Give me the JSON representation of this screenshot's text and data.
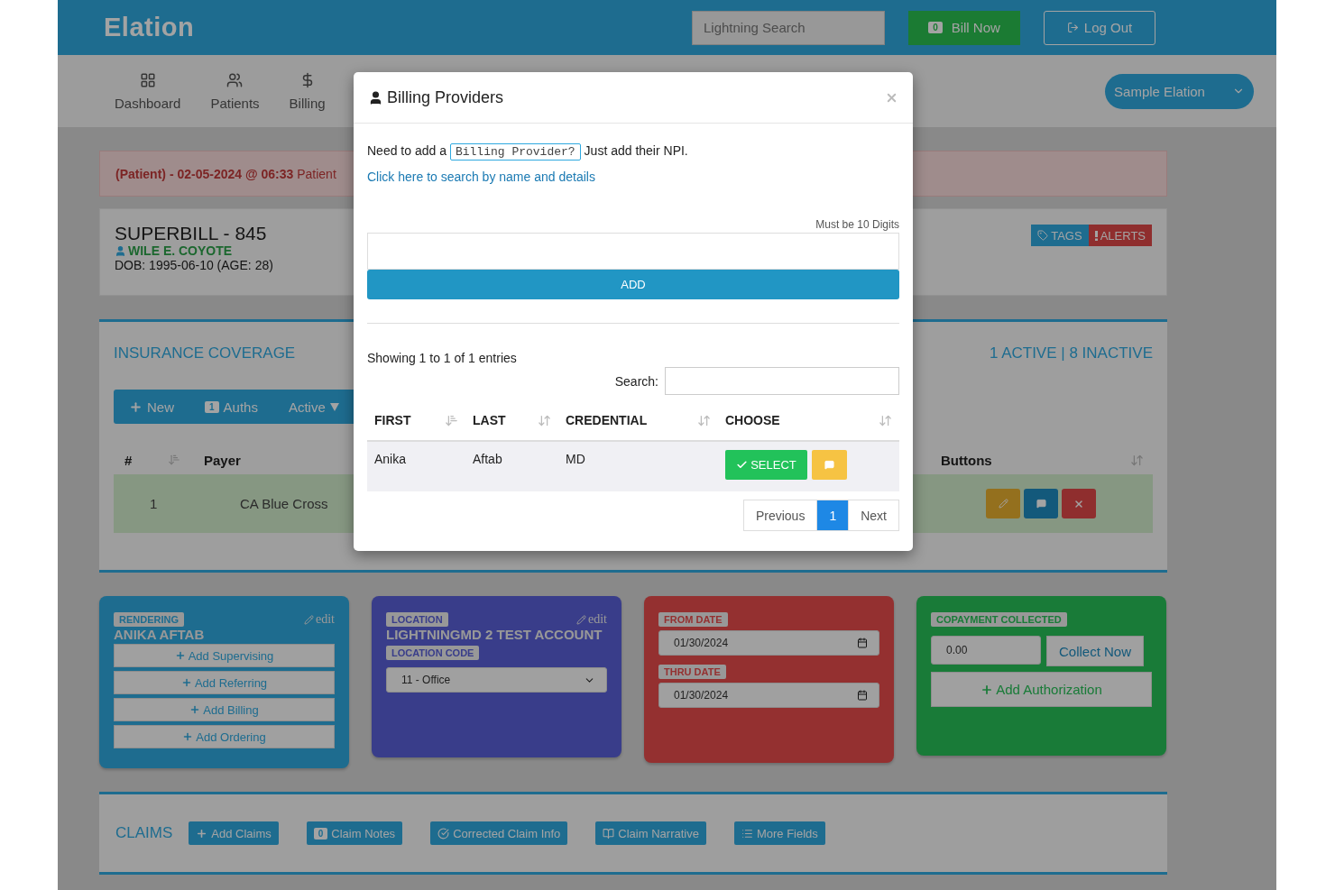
{
  "header": {
    "logo": "Elation",
    "search": {
      "placeholder": "Lightning Search"
    },
    "bill_now": {
      "badge": "0",
      "label": "Bill Now"
    },
    "logout": "Log Out"
  },
  "nav": {
    "items": [
      {
        "label": "Dashboard"
      },
      {
        "label": "Patients"
      },
      {
        "label": "Billing"
      }
    ],
    "account": "Sample Elation"
  },
  "alert": "**(Patient) - 02-05-2024 @ 06:33** Patient",
  "superbill": {
    "title": "SUPERBILL - 845",
    "patient": "WILE E. COYOTE",
    "dob": "DOB: 1995-06-10 (AGE: 28)",
    "tags": "TAGS",
    "alerts": "ALERTS"
  },
  "insurance": {
    "title": "INSURANCE COVERAGE",
    "summary": "1 ACTIVE | 8 INACTIVE",
    "toolbar": {
      "new": "New",
      "auths_badge": "1",
      "auths": "Auths",
      "active": "Active"
    },
    "columns": {
      "number": "#",
      "payer": "Payer",
      "buttons": "Buttons"
    },
    "rows": [
      {
        "number": "1",
        "payer": "CA Blue Cross"
      }
    ]
  },
  "cards": {
    "rendering": {
      "label": "RENDERING",
      "name": "ANIKA AFTAB",
      "edit": "edit",
      "buttons": [
        "Add Supervising",
        "Add Referring",
        "Add Billing",
        "Add Ordering"
      ]
    },
    "location": {
      "label": "LOCATION",
      "name": "LIGHTNINGMD 2 TEST ACCOUNT",
      "edit": "edit",
      "code_label": "LOCATION CODE",
      "code": "11 - Office"
    },
    "dates": {
      "from_label": "FROM DATE",
      "from": "01/30/2024",
      "thru_label": "THRU DATE",
      "thru": "01/30/2024"
    },
    "copay": {
      "label": "COPAYMENT COLLECTED",
      "value": "0.00",
      "collect": "Collect Now",
      "add": "Add Authorization"
    }
  },
  "claims": {
    "title": "CLAIMS",
    "buttons": [
      {
        "label": "Add Claims"
      },
      {
        "label": "Claim Notes",
        "badge": "0"
      },
      {
        "label": "Corrected Claim Info"
      },
      {
        "label": "Claim Narrative"
      },
      {
        "label": "More Fields"
      }
    ]
  },
  "modal": {
    "title": "Billing Providers",
    "intro": "Need to add a",
    "code": "Billing Provider?",
    "intro_after": "Just add their NPI.",
    "link": "Click here to search by name and details",
    "hint": "Must be 10 Digits",
    "add": "ADD",
    "info": "Showing 1 to 1 of 1 entries",
    "search_label": "Search:",
    "columns": [
      {
        "label": "FIRST",
        "sorted": true
      },
      {
        "label": "LAST",
        "sorted": false
      },
      {
        "label": "CREDENTIAL",
        "sorted": false
      },
      {
        "label": "CHOOSE",
        "sorted": false
      }
    ],
    "rows": [
      {
        "first": "Anika",
        "last": "Aftab",
        "credential": "MD",
        "select": "SELECT"
      }
    ],
    "pagination": {
      "previous": "Previous",
      "pages": [
        {
          "label": "1",
          "selected": true
        }
      ],
      "next": "Next"
    }
  }
}
